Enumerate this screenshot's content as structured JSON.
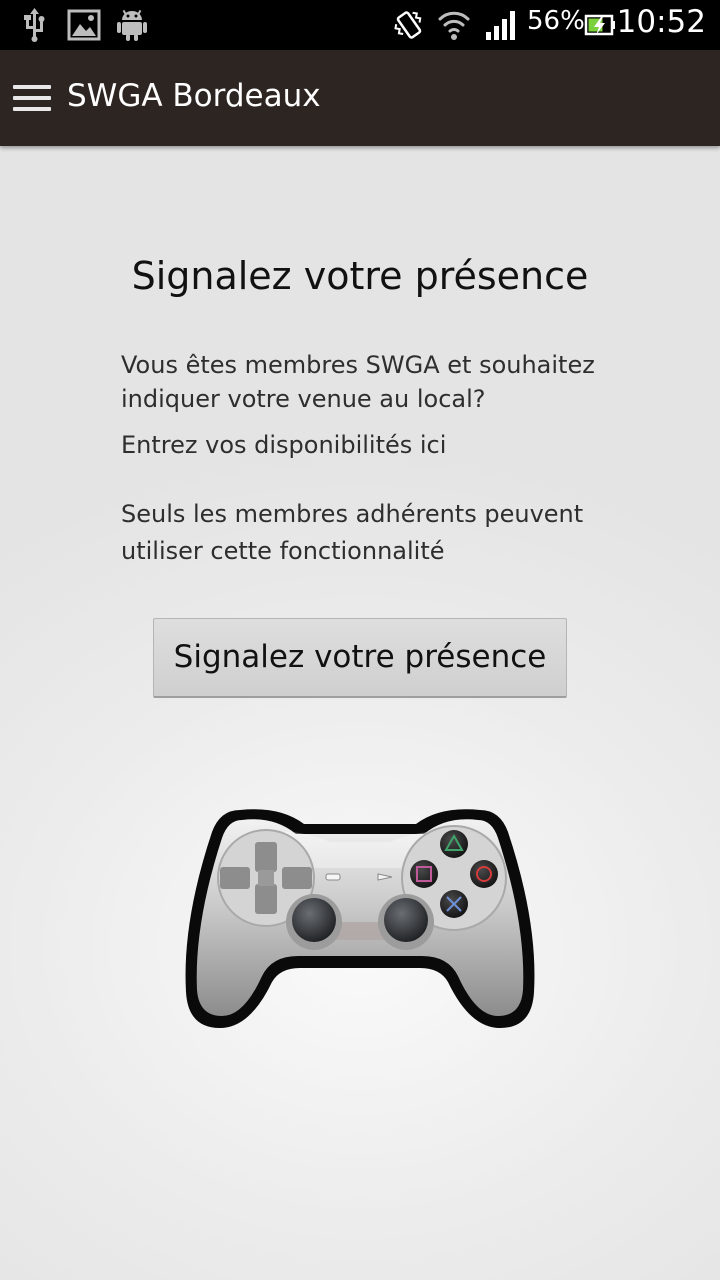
{
  "status_bar": {
    "icons": [
      "usb-icon",
      "image-icon",
      "android-icon",
      "vibrate-icon",
      "wifi-icon",
      "signal-icon",
      "battery-icon"
    ],
    "battery_percent": "56%",
    "time": "10:52"
  },
  "app_bar": {
    "menu_icon": "menu-icon",
    "title": "SWGA Bordeaux",
    "background": "#2d2522"
  },
  "main": {
    "heading": "Signalez votre présence",
    "paragraph_1": "Vous êtes membres SWGA et souhaitez indiquer votre venue au local?",
    "paragraph_2": "Entrez vos disponibilités ici",
    "paragraph_3": "Seuls les membres adhérents peuvent utiliser cette fonctionnalité",
    "button_label": "Signalez votre présence",
    "illustration": "gamepad-icon"
  }
}
